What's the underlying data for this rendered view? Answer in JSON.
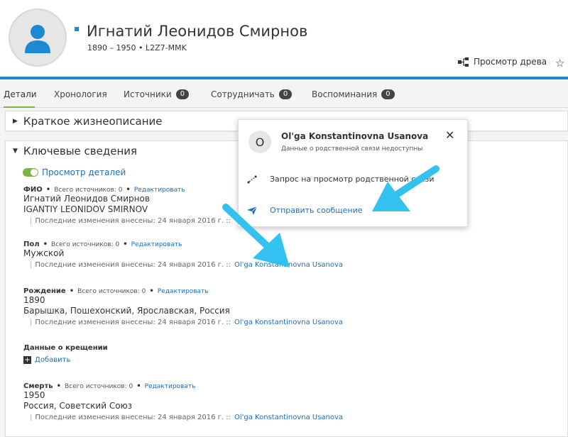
{
  "header": {
    "name": "Игнатий Леонидов Смирнов",
    "meta": "1890 – 1950 • L2Z7-MMK",
    "tree_view_label": "Просмотр древа"
  },
  "tabs": [
    {
      "label": "Детали",
      "count": null
    },
    {
      "label": "Хронология",
      "count": null
    },
    {
      "label": "Источники",
      "count": "0"
    },
    {
      "label": "Сотрудничать",
      "count": "0"
    },
    {
      "label": "Воспоминания",
      "count": "0"
    }
  ],
  "bio_panel": {
    "title": "Краткое жизнеописание"
  },
  "key_panel": {
    "title": "Ключевые сведения",
    "toggle_label": "Просмотр деталей",
    "dot": "•",
    "sources_label": "Всего источников: 0",
    "edit_label": "Редактировать",
    "changed_label": "Последние изменения внесены: 24 января 2016 г. ::",
    "changed_by": "Ol'ga Konstantinovna Usanova",
    "add_label": "Добавить",
    "facts": {
      "name": {
        "title": "ФИО",
        "lines": [
          "Игнатий Леонидов Смирнов",
          "IGANTIY LEONIDOV SMIRNOV"
        ]
      },
      "sex": {
        "title": "Пол",
        "lines": [
          "Мужской"
        ]
      },
      "birth": {
        "title": "Рождение",
        "lines": [
          "1890",
          "Барышка, Пошехонский, Ярославская, Россия"
        ]
      },
      "christening": {
        "title": "Данные о крещении"
      },
      "death": {
        "title": "Смерть",
        "lines": [
          "1950",
          "Россия, Советский Союз"
        ]
      }
    }
  },
  "popup": {
    "initial": "O",
    "name": "Ol'ga Konstantinovna Usanova",
    "subtitle": "Данные о родственной связи недоступны",
    "request_label": "Запрос на просмотр родственной связи",
    "message_label": "Отправить сообщение"
  },
  "colors": {
    "accent": "#1e88d0",
    "link": "#1e6fb7",
    "toggle": "#7cb342",
    "arrow": "#33c1f0"
  }
}
